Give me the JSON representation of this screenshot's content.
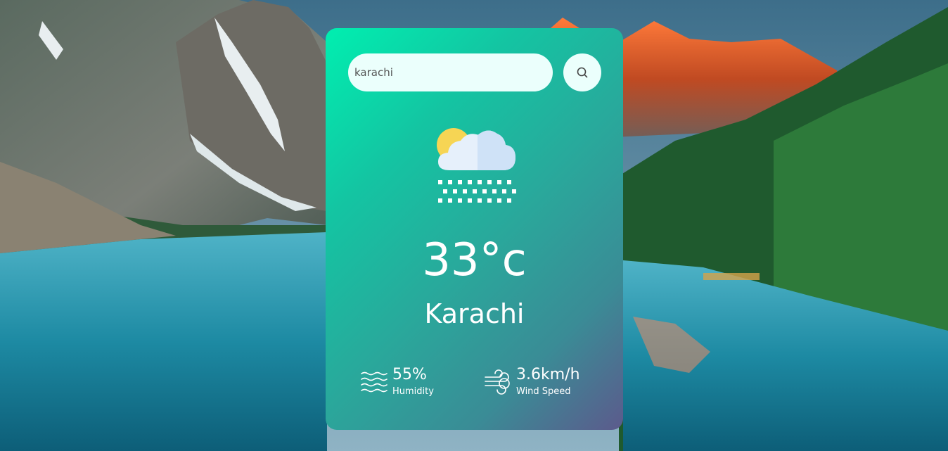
{
  "search": {
    "value": "karachi"
  },
  "weather": {
    "icon": "snow-cloud-sun-icon",
    "temperature": "33°c",
    "city": "Karachi"
  },
  "details": {
    "humidity_value": "55%",
    "humidity_label": "Humidity",
    "wind_value": "3.6km/h",
    "wind_label": "Wind Speed"
  },
  "colors": {
    "card_gradient_start": "#00efb0",
    "card_gradient_end": "#5c5a8c",
    "input_background": "#ebfffc",
    "text": "#ffffff"
  }
}
